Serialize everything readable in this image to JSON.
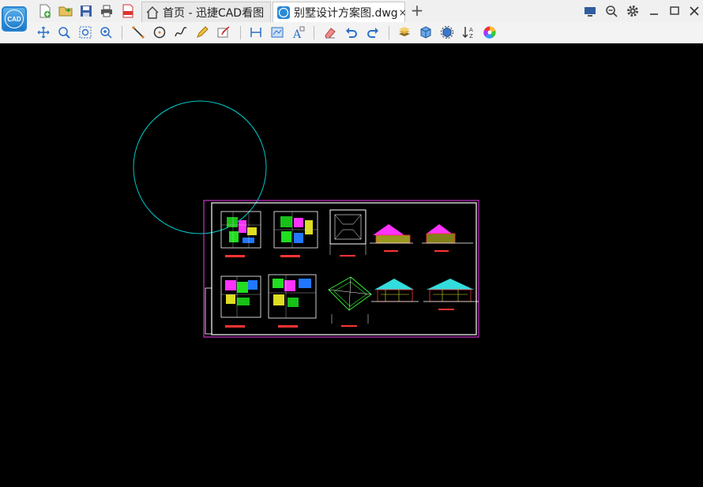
{
  "app": {
    "logo_text": "CAD"
  },
  "tabs": [
    {
      "label": "首页 - 迅捷CAD看图"
    },
    {
      "label": "别墅设计方案图.dwg",
      "close": "×"
    }
  ],
  "new_tab_symbol": "+",
  "quick_access": [
    "new-file",
    "open-file",
    "save",
    "print",
    "export-pdf"
  ],
  "toolbar_tools": [
    "pan",
    "zoom-window",
    "zoom-extents",
    "zoom-realtime",
    "line",
    "circle",
    "polyline",
    "pencil",
    "markup-text",
    "measure-distance",
    "measure-area",
    "text",
    "eraser",
    "undo",
    "redo",
    "layers",
    "3d-view",
    "3d-orbit",
    "sort-order",
    "color-wheel"
  ],
  "drawing": {
    "circle_color": "#00c8c8",
    "frame_color": "#cc33cc",
    "border_color": "#ffffff"
  }
}
